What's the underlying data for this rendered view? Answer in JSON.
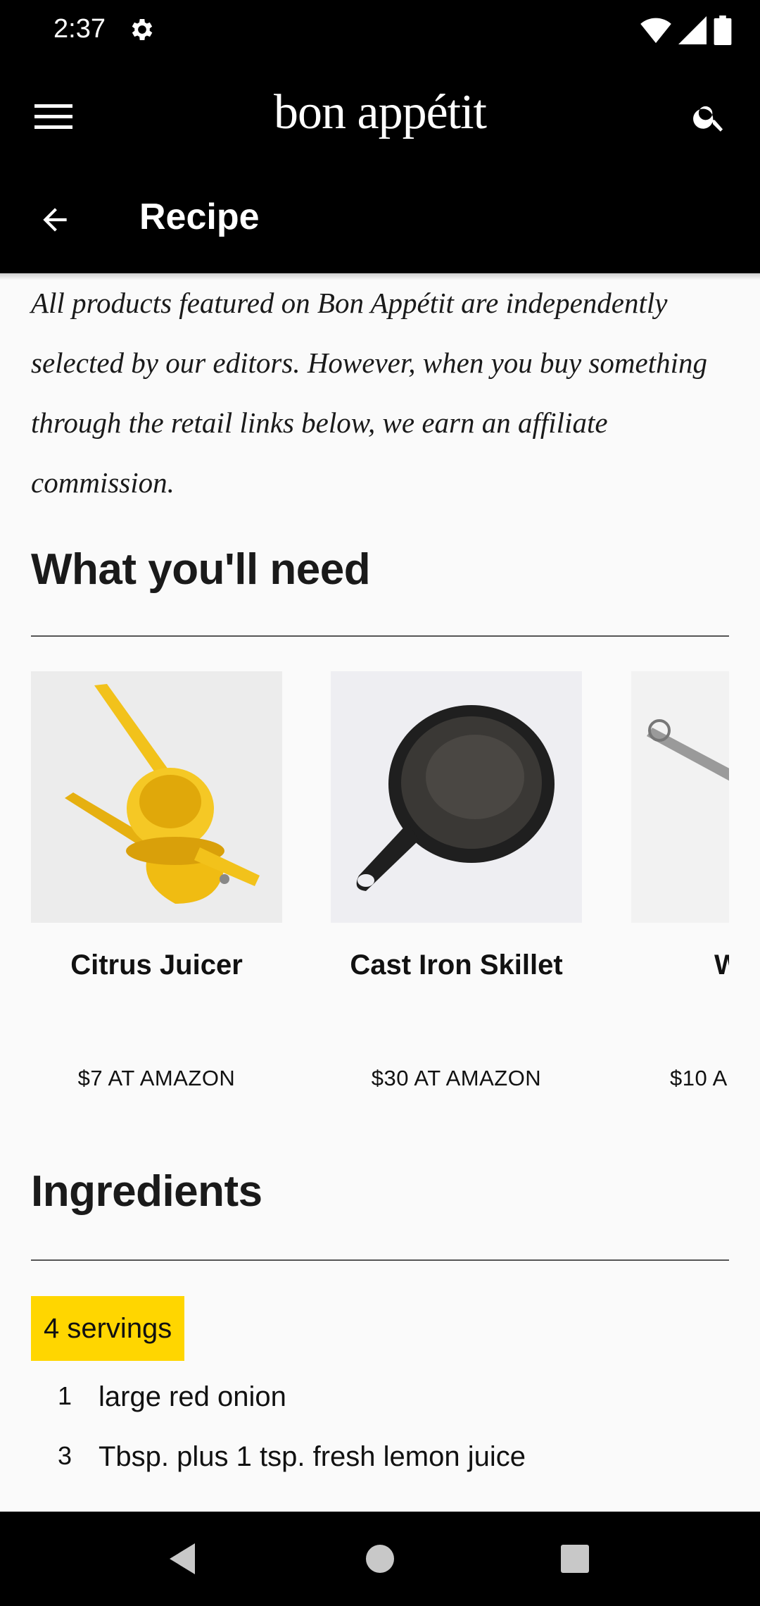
{
  "status_bar": {
    "time": "2:37",
    "icons": [
      "gear-icon",
      "wifi-icon",
      "signal-icon",
      "battery-icon"
    ]
  },
  "app_bar": {
    "brand": "bon appétit",
    "subtitle": "Recipe",
    "menu_icon": "menu-icon",
    "search_icon": "search-icon",
    "back_icon": "arrow-back-icon"
  },
  "disclaimer": "All products featured on Bon Appétit are independently selected by our editors. However, when you buy something through the retail links below, we earn an affiliate commission.",
  "need_section": {
    "title": "What you'll need",
    "products": [
      {
        "name": "Citrus Juicer",
        "price": "$7 AT AMAZON",
        "icon": "citrus-juicer-image"
      },
      {
        "name": "Cast Iron Skillet",
        "price": "$30 AT AMAZON",
        "icon": "cast-iron-skillet-image"
      },
      {
        "name": "W",
        "price": "$10 A",
        "icon": "whisk-image"
      }
    ]
  },
  "ingredients_section": {
    "title": "Ingredients",
    "servings": "4 servings",
    "items": [
      {
        "qty": "1",
        "text": "large red onion"
      },
      {
        "qty": "3",
        "text": "Tbsp. plus 1 tsp. fresh lemon juice"
      }
    ]
  },
  "colors": {
    "accent": "#ffd600",
    "bar": "#000000",
    "background": "#fafafa"
  }
}
